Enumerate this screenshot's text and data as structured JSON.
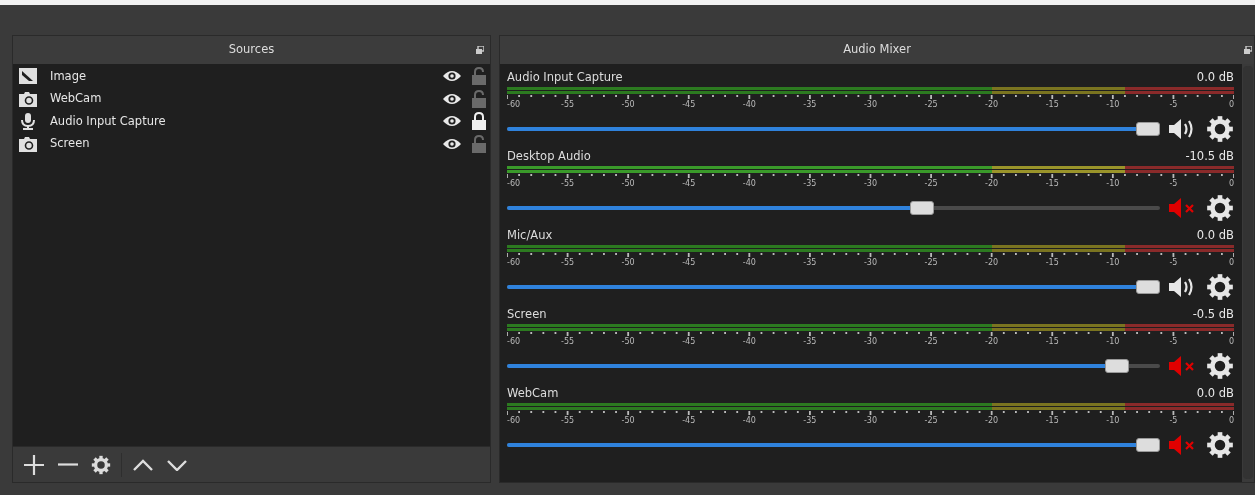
{
  "sources": {
    "title": "Sources",
    "items": [
      {
        "name": "Image",
        "kind": "image",
        "visible": true,
        "locked": false
      },
      {
        "name": "WebCam",
        "kind": "camera",
        "visible": true,
        "locked": false
      },
      {
        "name": "Audio Input Capture",
        "kind": "microphone",
        "visible": true,
        "locked": true
      },
      {
        "name": "Screen",
        "kind": "camera",
        "visible": true,
        "locked": false
      }
    ]
  },
  "audio_mixer": {
    "title": "Audio Mixer",
    "channels": [
      {
        "name": "Audio Input Capture",
        "reading": "0.0 dB",
        "level": 1.0,
        "muted": false,
        "scale": [
          "-60",
          "-55",
          "-50",
          "-45",
          "-40",
          "-35",
          "-30",
          "-25",
          "-20",
          "-15",
          "-10",
          "-5",
          "0"
        ]
      },
      {
        "name": "Desktop Audio",
        "reading": "-10.5 dB",
        "level": 0.64,
        "muted": true,
        "scale": [
          "-60",
          "-55",
          "-50",
          "-45",
          "-40",
          "-35",
          "-30",
          "-25",
          "-20",
          "-15",
          "-10",
          "-5",
          "0"
        ]
      },
      {
        "name": "Mic/Aux",
        "reading": "0.0 dB",
        "level": 1.0,
        "muted": false,
        "scale": [
          "-60",
          "-55",
          "-50",
          "-45",
          "-40",
          "-35",
          "-30",
          "-25",
          "-20",
          "-15",
          "-10",
          "-5",
          "0"
        ]
      },
      {
        "name": "Screen",
        "reading": "-0.5 dB",
        "level": 0.95,
        "muted": true,
        "scale": [
          "-60",
          "-55",
          "-50",
          "-45",
          "-40",
          "-35",
          "-30",
          "-25",
          "-20",
          "-15",
          "-10",
          "-5",
          "0"
        ]
      },
      {
        "name": "WebCam",
        "reading": "0.0 dB",
        "level": 1.0,
        "muted": true,
        "scale": [
          "-60",
          "-55",
          "-50",
          "-45",
          "-40",
          "-35",
          "-30",
          "-25",
          "-20",
          "-15",
          "-10",
          "-5",
          "0"
        ]
      }
    ]
  }
}
